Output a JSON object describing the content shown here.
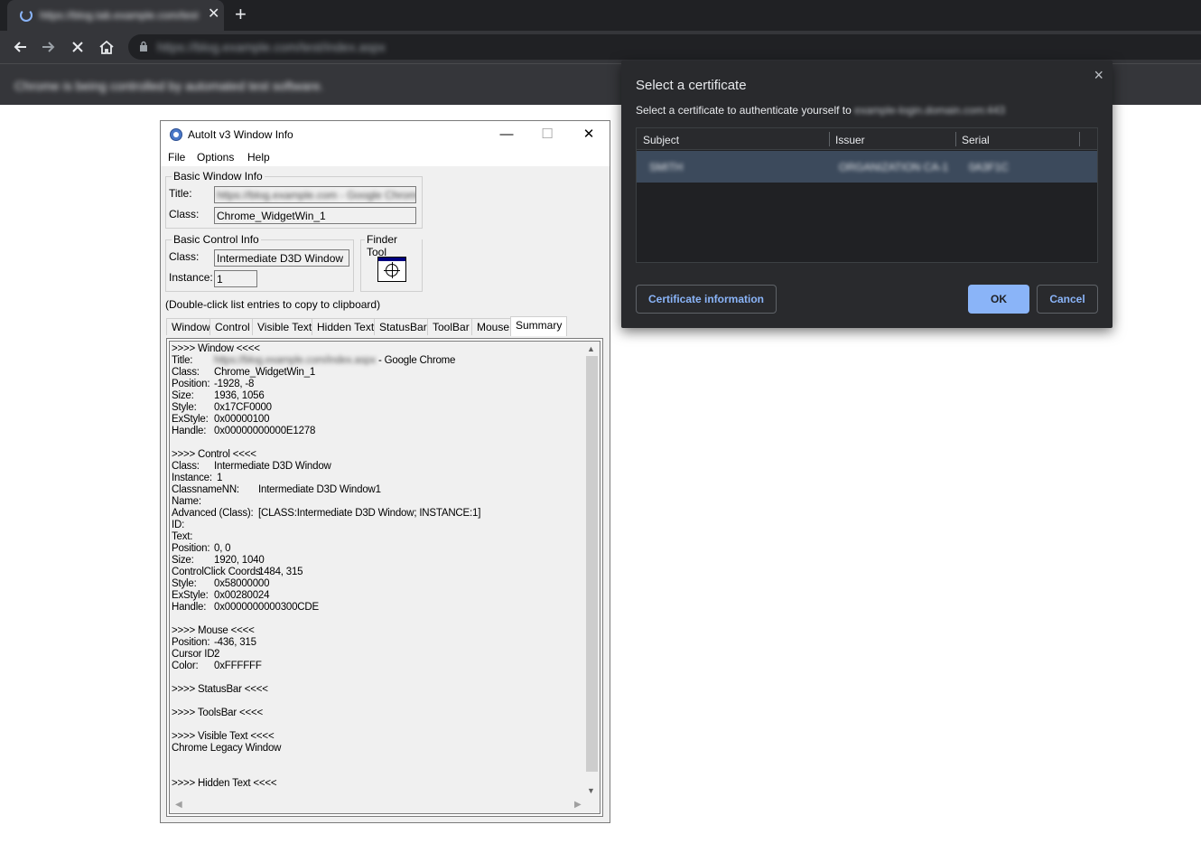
{
  "browser": {
    "tab_title": "https://blog.tab.example.com/test",
    "tab_close": "✕",
    "new_tab": "+",
    "url": "https://blog.example.com/test/index.aspx",
    "infobar_message": "Chrome is being controlled by automated test software."
  },
  "cert_dialog": {
    "title": "Select a certificate",
    "subtitle": "Select a certificate to authenticate yourself to",
    "subtitle_host": "example-login.domain.com:443",
    "close": "×",
    "columns": [
      "Subject",
      "Issuer",
      "Serial"
    ],
    "rows": [
      {
        "subject": "SMITH",
        "issuer": "ORGANIZATION CA-1",
        "serial": "0A3F1C"
      }
    ],
    "cert_info_label": "Certificate information",
    "ok_label": "OK",
    "cancel_label": "Cancel"
  },
  "autoit": {
    "title": "AutoIt v3 Window Info",
    "minimize": "—",
    "maximize": "☐",
    "close": "✕",
    "menu": [
      "File",
      "Options",
      "Help"
    ],
    "basic_window": {
      "legend": "Basic Window Info",
      "title_label": "Title:",
      "title_value": "https://blog.example.com - Google Chrome",
      "class_label": "Class:",
      "class_value": "Chrome_WidgetWin_1"
    },
    "basic_control": {
      "legend": "Basic Control Info",
      "class_label": "Class:",
      "class_value": "Intermediate D3D Window",
      "instance_label": "Instance:",
      "instance_value": "1"
    },
    "finder_tool": "Finder Tool",
    "hint": "(Double-click list entries to copy to clipboard)",
    "tabs": [
      "Window",
      "Control",
      "Visible Text",
      "Hidden Text",
      "StatusBar",
      "ToolBar",
      "Mouse",
      "Summary"
    ],
    "active_tab": "Summary",
    "summary": {
      "window_header": ">>>> Window <<<<",
      "title_label": "Title:",
      "title_blur": "https://blog.example.com/index.aspx",
      "title_suffix": " - Google Chrome",
      "class_label": "Class:",
      "class_value": "Chrome_WidgetWin_1",
      "position_label": "Position:",
      "position_value": "-1928, -8",
      "size_label": "Size:",
      "size_value": "1936, 1056",
      "style_label": "Style:",
      "style_value": "0x17CF0000",
      "exstyle_label": "ExStyle:",
      "exstyle_value": "0x00000100",
      "handle_label": "Handle:",
      "handle_value": "0x00000000000E1278",
      "control_header": ">>>> Control <<<<",
      "c_class_label": "Class:",
      "c_class_value": "Intermediate D3D Window",
      "c_instance_label": "Instance:",
      "c_instance_value": "1",
      "c_classnn_label": "ClassnameNN:",
      "c_classnn_value": "Intermediate D3D Window1",
      "c_name_label": "Name:",
      "c_advanced_label": "Advanced (Class):",
      "c_advanced_value": "[CLASS:Intermediate D3D Window; INSTANCE:1]",
      "c_id_label": "ID:",
      "c_text_label": "Text:",
      "c_position_label": "Position:",
      "c_position_value": "0, 0",
      "c_size_label": "Size:",
      "c_size_value": "1920, 1040",
      "c_click_label": "ControlClick Coords:",
      "c_click_value": "1484, 315",
      "c_style_label": "Style:",
      "c_style_value": "0x58000000",
      "c_exstyle_label": "ExStyle:",
      "c_exstyle_value": "0x00280024",
      "c_handle_label": "Handle:",
      "c_handle_value": "0x0000000000300CDE",
      "mouse_header": ">>>> Mouse <<<<",
      "m_position_label": "Position:",
      "m_position_value": "-436, 315",
      "m_cursor_label": "Cursor ID:",
      "m_cursor_value": "2",
      "m_color_label": "Color:",
      "m_color_value": "0xFFFFFF",
      "statusbar_header": ">>>> StatusBar <<<<",
      "toolsbar_header": ">>>> ToolsBar <<<<",
      "visible_header": ">>>> Visible Text <<<<",
      "visible_value": "Chrome Legacy Window",
      "hidden_header": ">>>> Hidden Text <<<<"
    }
  }
}
